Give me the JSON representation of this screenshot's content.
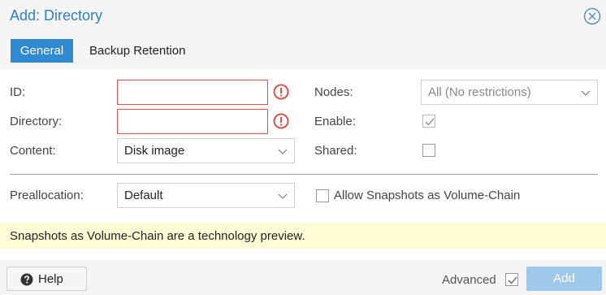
{
  "dialog": {
    "title": "Add: Directory"
  },
  "tabs": [
    {
      "label": "General",
      "active": true
    },
    {
      "label": "Backup Retention",
      "active": false
    }
  ],
  "form": {
    "id": {
      "label": "ID:",
      "value": "",
      "invalid": true
    },
    "directory": {
      "label": "Directory:",
      "value": "",
      "invalid": true
    },
    "content": {
      "label": "Content:",
      "value": "Disk image"
    },
    "nodes": {
      "label": "Nodes:",
      "value": "All (No restrictions)"
    },
    "enable": {
      "label": "Enable:",
      "checked": true,
      "disabled": true
    },
    "shared": {
      "label": "Shared:",
      "checked": false
    },
    "preallocation": {
      "label": "Preallocation:",
      "value": "Default"
    },
    "allow_snapshots": {
      "label": "Allow Snapshots as Volume-Chain",
      "checked": false
    }
  },
  "notice": "Snapshots as Volume-Chain are a technology preview.",
  "footer": {
    "help_label": "Help",
    "advanced_label": "Advanced",
    "advanced_checked": true,
    "add_label": "Add",
    "add_disabled": true
  },
  "colors": {
    "accent": "#2f8ad1",
    "title": "#2f7ec2",
    "error": "#d9534f",
    "notice_bg": "#fefdd6",
    "add_disabled": "#9fc9ea"
  },
  "icons": {
    "close": "close-circle-icon",
    "warning": "exclamation-circle-icon",
    "dropdown": "chevron-down-icon",
    "help": "question-circle-icon",
    "check": "check-icon"
  }
}
